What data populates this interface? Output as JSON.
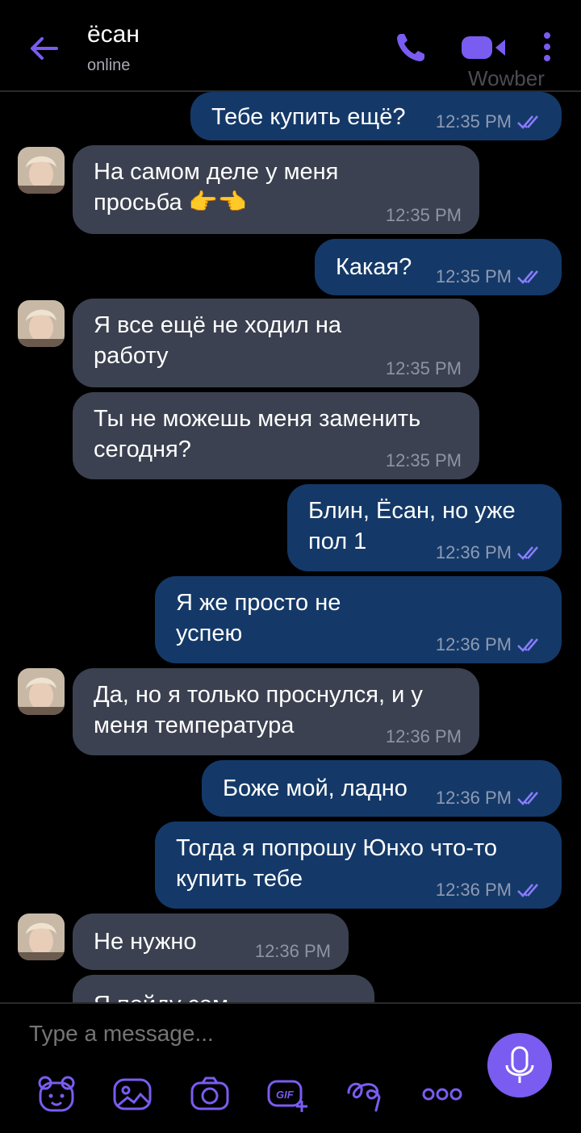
{
  "header": {
    "contact_name": "ёсан",
    "status": "online",
    "watermark": "Wowber",
    "icons": [
      "back-arrow-icon",
      "phone-icon",
      "video-call-icon",
      "more-vertical-icon"
    ],
    "accent": "#7a5cf0"
  },
  "messages": [
    {
      "dir": "out",
      "text": "Тебе купить ещё?",
      "time": "12:35 PM"
    },
    {
      "dir": "in",
      "text": "На самом деле у меня\nпросьба 👉👈",
      "time": "12:35 PM"
    },
    {
      "dir": "out",
      "text": "Какая?",
      "time": "12:35 PM"
    },
    {
      "dir": "in",
      "text": "Я все ещё не ходил на\nработу",
      "time": "12:35 PM"
    },
    {
      "dir": "in",
      "text": "Ты не можешь меня заменить\nсегодня?",
      "time": "12:35 PM"
    },
    {
      "dir": "out",
      "text": "Блин, Ёсан, но уже\nпол 1",
      "time": "12:36 PM"
    },
    {
      "dir": "out",
      "text": "Я же просто не\nуспею",
      "time": "12:36 PM"
    },
    {
      "dir": "in",
      "text": "Да, но я только проснулся, и у\nменя температура",
      "time": "12:36 PM"
    },
    {
      "dir": "out",
      "text": "Боже мой, ладно",
      "time": "12:36 PM"
    },
    {
      "dir": "out",
      "text": "Тогда я попрошу Юнхо что-то\nкупить тебе",
      "time": "12:36 PM"
    },
    {
      "dir": "in",
      "text": "Не нужно",
      "time": "12:36 PM"
    },
    {
      "dir": "in",
      "text": "Я пойду сам",
      "time": ""
    }
  ],
  "composer": {
    "placeholder": "Type a message...",
    "tools": [
      "sticker-bear-icon",
      "gallery-icon",
      "camera-icon",
      "gif-icon",
      "doodle-icon",
      "more-horizontal-icon"
    ],
    "send_icon": "microphone-icon"
  },
  "colors": {
    "outgoing_bubble": "#143968",
    "incoming_bubble": "#3b4150",
    "read_ticks": "#8a7cff"
  }
}
